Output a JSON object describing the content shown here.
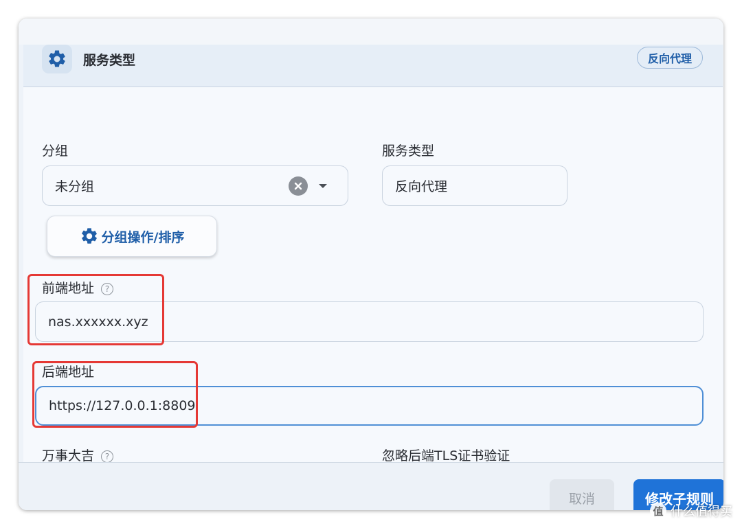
{
  "header": {
    "title": "服务类型",
    "type_pill": "反向代理",
    "gear_icon": "gear-icon"
  },
  "form": {
    "group": {
      "label": "分组",
      "value": "未分组"
    },
    "service_type": {
      "label": "服务类型",
      "value": "反向代理"
    },
    "group_ops_button": "分组操作/排序",
    "frontend": {
      "label": "前端地址",
      "value": "nas.xxxxxx.xyz"
    },
    "backend": {
      "label": "后端地址",
      "value": "https://127.0.0.1:8809"
    },
    "wanshi": {
      "label": "万事大吉"
    },
    "skip_tls": {
      "label": "忽略后端TLS证书验证"
    }
  },
  "footer": {
    "cancel": "取消",
    "modify": "修改子规则"
  },
  "watermark": {
    "badge": "值",
    "text": "什么值得买"
  },
  "colors": {
    "accent": "#1f73d8",
    "highlight": "#e53935"
  }
}
